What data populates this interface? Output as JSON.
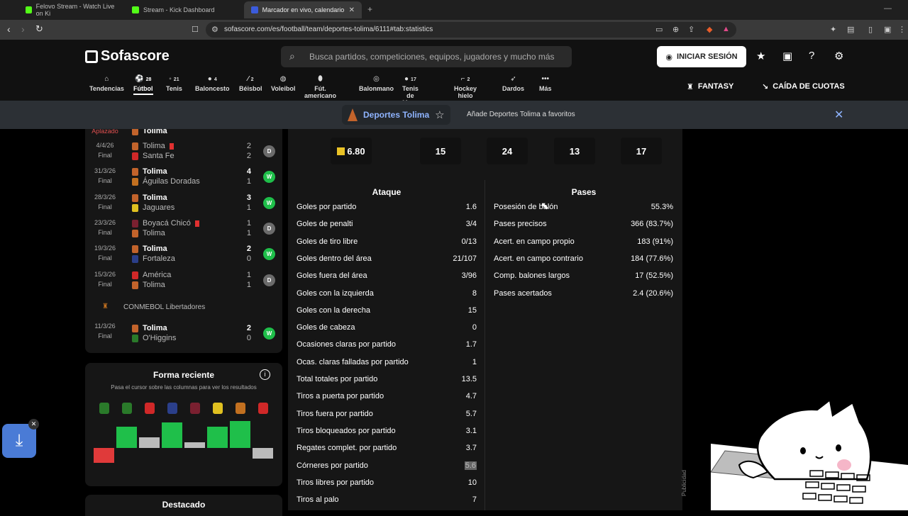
{
  "browser": {
    "tabs": [
      {
        "title": "Felovo Stream - Watch Live on Ki",
        "color": "#53fc18"
      },
      {
        "title": "Stream - Kick Dashboard",
        "color": "#53fc18"
      },
      {
        "title": "Marcador en vivo, calendario y r",
        "color": "#3b5bdb"
      }
    ],
    "url": "sofascore.com/es/football/team/deportes-tolima/6111#tab:statistics",
    "new_tab": "+"
  },
  "header": {
    "logo": "Sofascore",
    "search_placeholder": "Busca partidos, competiciones, equipos, jugadores y mucho más",
    "login_label": "INICIAR SESIÓN",
    "fantasy_label": "FANTASY",
    "odds_label": "CAÍDA DE CUOTAS"
  },
  "sports": [
    {
      "label": "Tendencias",
      "count": ""
    },
    {
      "label": "Fútbol",
      "count": "28"
    },
    {
      "label": "Tenis",
      "count": "21"
    },
    {
      "label": "Baloncesto",
      "count": "4"
    },
    {
      "label": "Béisbol",
      "count": "2"
    },
    {
      "label": "Voleibol",
      "count": ""
    },
    {
      "label": "Fút. americano",
      "count": ""
    },
    {
      "label": "Balonmano",
      "count": ""
    },
    {
      "label": "Tenis de Mesa",
      "count": "17"
    },
    {
      "label": "Hockey hielo",
      "count": "2"
    },
    {
      "label": "Dardos",
      "count": ""
    },
    {
      "label": "Más",
      "count": ""
    }
  ],
  "favorite_banner": {
    "team": "Deportes Tolima",
    "text": "Añade Deportes Tolima a favoritos"
  },
  "matches": [
    {
      "date": "",
      "status": "Aplazado",
      "home": "Tolima",
      "away": "",
      "hs": "",
      "as": "",
      "result": ""
    },
    {
      "date": "4/4/26",
      "status": "Final",
      "home": "Tolima",
      "away": "Santa Fe",
      "hs": "2",
      "as": "2",
      "result": "D"
    },
    {
      "date": "31/3/26",
      "status": "Final",
      "home": "Tolima",
      "away": "Águilas Doradas",
      "hs": "4",
      "as": "1",
      "result": "W"
    },
    {
      "date": "28/3/26",
      "status": "Final",
      "home": "Tolima",
      "away": "Jaguares",
      "hs": "3",
      "as": "1",
      "result": "W"
    },
    {
      "date": "23/3/26",
      "status": "Final",
      "home": "Boyacá Chicó",
      "away": "Tolima",
      "hs": "1",
      "as": "1",
      "result": "D"
    },
    {
      "date": "19/3/26",
      "status": "Final",
      "home": "Tolima",
      "away": "Fortaleza",
      "hs": "2",
      "as": "0",
      "result": "W"
    },
    {
      "date": "15/3/26",
      "status": "Final",
      "home": "América",
      "away": "Tolima",
      "hs": "1",
      "as": "1",
      "result": "D"
    },
    {
      "date": "11/3/26",
      "status": "Final",
      "home": "Tolima",
      "away": "O'Higgins",
      "hs": "2",
      "as": "0",
      "result": "W"
    }
  ],
  "league_label": "CONMEBOL Libertadores",
  "form": {
    "title": "Forma reciente",
    "subtitle": "Pasa el cursor sobre las columnas para ver los resultados",
    "bars": [
      {
        "dir": "down",
        "size": 0.55,
        "color": "#e03a3a",
        "crest": "#2a7a2a"
      },
      {
        "dir": "up",
        "size": 0.8,
        "color": "#1fbf4a",
        "crest": "#2a7a2a"
      },
      {
        "dir": "up",
        "size": 0.4,
        "color": "#bbbbbb",
        "crest": "#d02828"
      },
      {
        "dir": "up",
        "size": 0.95,
        "color": "#1fbf4a",
        "crest": "#2b3f8a"
      },
      {
        "dir": "up",
        "size": 0.2,
        "color": "#bbbbbb",
        "crest": "#7a2030"
      },
      {
        "dir": "up",
        "size": 0.8,
        "color": "#1fbf4a",
        "crest": "#e0c020"
      },
      {
        "dir": "up",
        "size": 1.0,
        "color": "#1fbf4a",
        "crest": "#c27020"
      },
      {
        "dir": "down",
        "size": 0.4,
        "color": "#bbbbbb",
        "crest": "#d02828"
      }
    ]
  },
  "featured_title": "Destacado",
  "summary": {
    "rating": "6.80",
    "items": [
      "15",
      "24",
      "13",
      "17"
    ]
  },
  "attack": {
    "title": "Ataque",
    "rows": [
      {
        "label": "Goles por partido",
        "value": "1.6"
      },
      {
        "label": "Goles de penalti",
        "value": "3/4"
      },
      {
        "label": "Goles de tiro libre",
        "value": "0/13"
      },
      {
        "label": "Goles dentro del área",
        "value": "21/107"
      },
      {
        "label": "Goles fuera del área",
        "value": "3/96"
      },
      {
        "label": "Goles con la izquierda",
        "value": "8"
      },
      {
        "label": "Goles con la derecha",
        "value": "15"
      },
      {
        "label": "Goles de cabeza",
        "value": "0"
      },
      {
        "label": "Ocasiones claras por partido",
        "value": "1.7"
      },
      {
        "label": "Ocas. claras falladas por partido",
        "value": "1"
      },
      {
        "label": "Total totales por partido",
        "value": "13.5"
      },
      {
        "label": "Tiros a puerta por partido",
        "value": "4.7"
      },
      {
        "label": "Tiros fuera por partido",
        "value": "5.7"
      },
      {
        "label": "Tiros bloqueados por partido",
        "value": "3.1"
      },
      {
        "label": "Regates complet. por partido",
        "value": "3.7"
      },
      {
        "label": "Córneres por partido",
        "value": "5.6"
      },
      {
        "label": "Tiros libres por partido",
        "value": "10"
      },
      {
        "label": "Tiros al palo",
        "value": "7"
      }
    ]
  },
  "passes": {
    "title": "Pases",
    "rows": [
      {
        "label": "Posesión de balón",
        "value": "55.3%"
      },
      {
        "label": "Pases precisos",
        "value": "366 (83.7%)"
      },
      {
        "label": "Acert. en campo propio",
        "value": "183 (91%)"
      },
      {
        "label": "Acert. en campo contrario",
        "value": "184 (77.6%)"
      },
      {
        "label": "Comp. balones largos",
        "value": "17 (52.5%)"
      },
      {
        "label": "Pases acertados",
        "value": "2.4 (20.6%)"
      }
    ]
  },
  "ad_label": "Publicidad"
}
